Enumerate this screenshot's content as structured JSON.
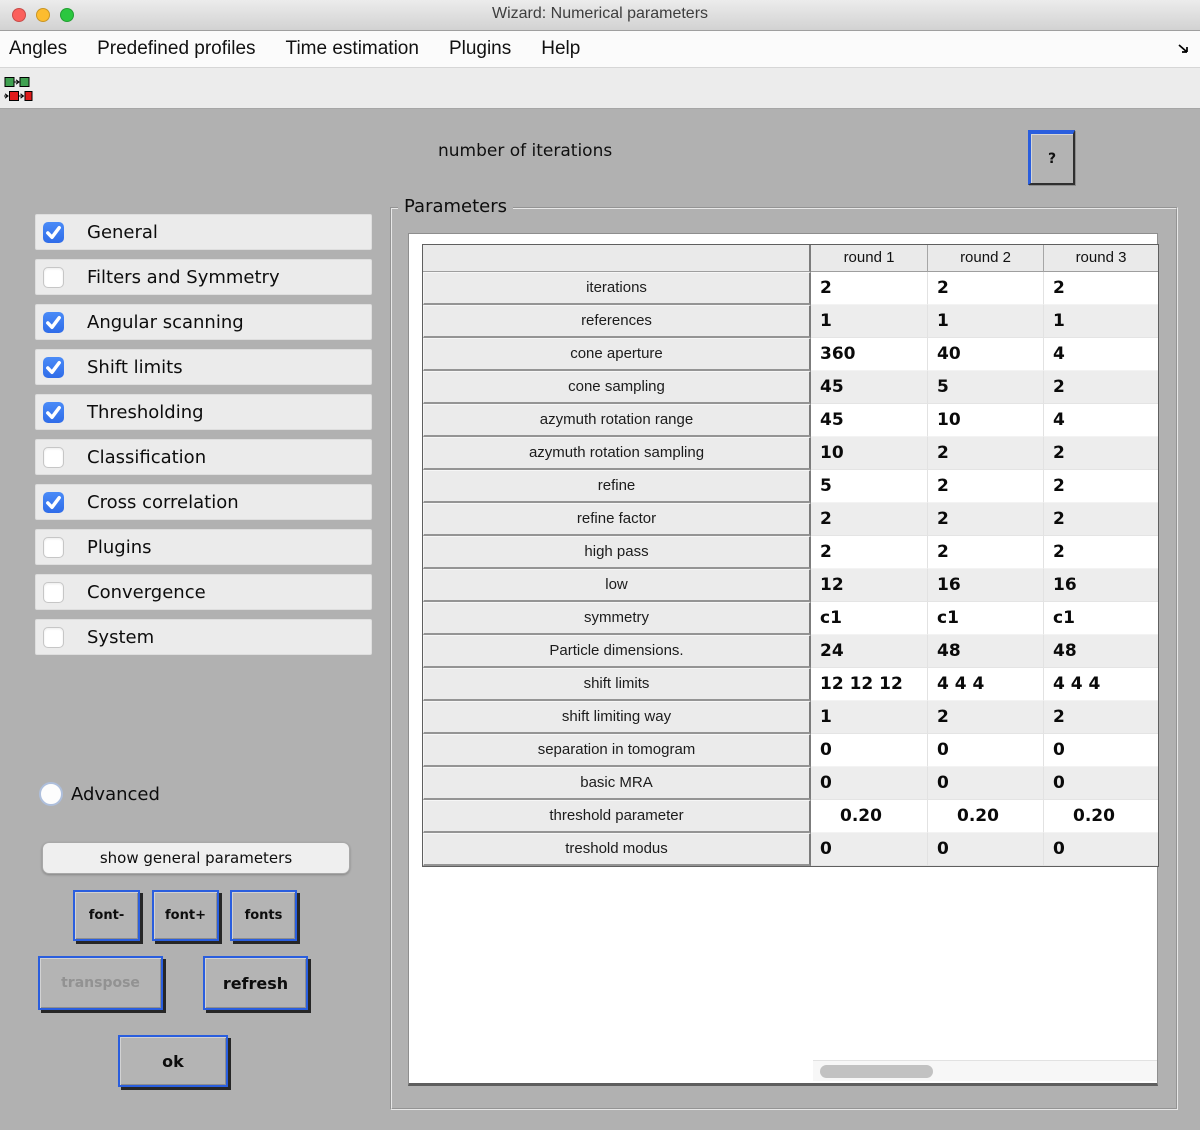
{
  "window": {
    "title": "Wizard: Numerical parameters"
  },
  "menu": {
    "items": [
      "Angles",
      "Predefined profiles",
      "Time estimation",
      "Plugins",
      "Help"
    ]
  },
  "toolbar": {
    "icons": [
      "chain-link-green-icon",
      "chain-link-red-icon"
    ]
  },
  "header": {
    "hint": "number of iterations",
    "help_label": "?"
  },
  "sidebar": {
    "items": [
      {
        "label": "General",
        "checked": true
      },
      {
        "label": "Filters and Symmetry",
        "checked": false
      },
      {
        "label": "Angular scanning",
        "checked": true
      },
      {
        "label": "Shift limits",
        "checked": true
      },
      {
        "label": "Thresholding",
        "checked": true
      },
      {
        "label": "Classification",
        "checked": false
      },
      {
        "label": "Cross correlation",
        "checked": true
      },
      {
        "label": "Plugins",
        "checked": false
      },
      {
        "label": "Convergence",
        "checked": false
      },
      {
        "label": "System",
        "checked": false
      }
    ],
    "advanced_label": "Advanced",
    "advanced_selected": false
  },
  "buttons": {
    "show_general": "show general parameters",
    "font_minus": "font-",
    "font_plus": "font+",
    "fonts": "fonts",
    "transpose": "transpose",
    "transpose_enabled": false,
    "refresh": "refresh",
    "ok": "ok"
  },
  "parameters": {
    "group_label": "Parameters",
    "columns": [
      "round 1",
      "round 2",
      "round 3"
    ],
    "rows": [
      {
        "label": "iterations",
        "values": [
          "2",
          "2",
          "2"
        ]
      },
      {
        "label": "references",
        "values": [
          "1",
          "1",
          "1"
        ]
      },
      {
        "label": "cone aperture",
        "values": [
          "360",
          "40",
          "4"
        ]
      },
      {
        "label": "cone sampling",
        "values": [
          "45",
          "5",
          "2"
        ]
      },
      {
        "label": "azymuth rotation range",
        "values": [
          "45",
          "10",
          "4"
        ]
      },
      {
        "label": "azymuth rotation sampling",
        "values": [
          "10",
          "2",
          "2"
        ]
      },
      {
        "label": "refine",
        "values": [
          "5",
          "2",
          "2"
        ]
      },
      {
        "label": "refine factor",
        "values": [
          "2",
          "2",
          "2"
        ]
      },
      {
        "label": "high pass",
        "values": [
          "2",
          "2",
          "2"
        ]
      },
      {
        "label": "low",
        "values": [
          "12",
          "16",
          "16"
        ]
      },
      {
        "label": "symmetry",
        "values": [
          "c1",
          "c1",
          "c1"
        ]
      },
      {
        "label": "Particle dimensions.",
        "values": [
          "24",
          "48",
          "48"
        ]
      },
      {
        "label": "shift limits",
        "values": [
          "12 12 12",
          "4 4 4",
          "4 4 4"
        ]
      },
      {
        "label": "shift limiting way",
        "values": [
          "1",
          "2",
          "2"
        ]
      },
      {
        "label": "separation in tomogram",
        "values": [
          "0",
          "0",
          "0"
        ]
      },
      {
        "label": "basic MRA",
        "values": [
          "0",
          "0",
          "0"
        ]
      },
      {
        "label": "threshold parameter",
        "values": [
          "0.20",
          "0.20",
          "0.20"
        ],
        "indent": true
      },
      {
        "label": "treshold modus",
        "values": [
          "0",
          "0",
          "0"
        ]
      }
    ]
  },
  "colors": {
    "background": "#b1b1b1",
    "accent_blue": "#2a5ede",
    "checkbox_blue": "#3b7cf3",
    "bar_light": "#ebebeb",
    "row_alt": "#ededed",
    "panel_white": "#ffffff",
    "traffic_red": "#fb605c",
    "traffic_yellow": "#fdbc2f",
    "traffic_green": "#2bc73f"
  }
}
